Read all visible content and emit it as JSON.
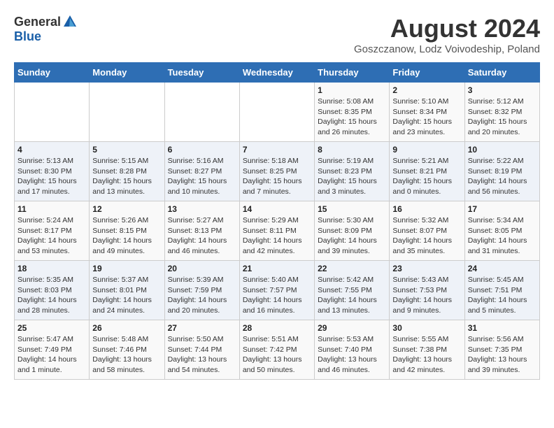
{
  "header": {
    "logo_general": "General",
    "logo_blue": "Blue",
    "title": "August 2024",
    "location": "Goszczanow, Lodz Voivodeship, Poland"
  },
  "weekdays": [
    "Sunday",
    "Monday",
    "Tuesday",
    "Wednesday",
    "Thursday",
    "Friday",
    "Saturday"
  ],
  "weeks": [
    [
      {
        "day": "",
        "info": ""
      },
      {
        "day": "",
        "info": ""
      },
      {
        "day": "",
        "info": ""
      },
      {
        "day": "",
        "info": ""
      },
      {
        "day": "1",
        "info": "Sunrise: 5:08 AM\nSunset: 8:35 PM\nDaylight: 15 hours\nand 26 minutes."
      },
      {
        "day": "2",
        "info": "Sunrise: 5:10 AM\nSunset: 8:34 PM\nDaylight: 15 hours\nand 23 minutes."
      },
      {
        "day": "3",
        "info": "Sunrise: 5:12 AM\nSunset: 8:32 PM\nDaylight: 15 hours\nand 20 minutes."
      }
    ],
    [
      {
        "day": "4",
        "info": "Sunrise: 5:13 AM\nSunset: 8:30 PM\nDaylight: 15 hours\nand 17 minutes."
      },
      {
        "day": "5",
        "info": "Sunrise: 5:15 AM\nSunset: 8:28 PM\nDaylight: 15 hours\nand 13 minutes."
      },
      {
        "day": "6",
        "info": "Sunrise: 5:16 AM\nSunset: 8:27 PM\nDaylight: 15 hours\nand 10 minutes."
      },
      {
        "day": "7",
        "info": "Sunrise: 5:18 AM\nSunset: 8:25 PM\nDaylight: 15 hours\nand 7 minutes."
      },
      {
        "day": "8",
        "info": "Sunrise: 5:19 AM\nSunset: 8:23 PM\nDaylight: 15 hours\nand 3 minutes."
      },
      {
        "day": "9",
        "info": "Sunrise: 5:21 AM\nSunset: 8:21 PM\nDaylight: 15 hours\nand 0 minutes."
      },
      {
        "day": "10",
        "info": "Sunrise: 5:22 AM\nSunset: 8:19 PM\nDaylight: 14 hours\nand 56 minutes."
      }
    ],
    [
      {
        "day": "11",
        "info": "Sunrise: 5:24 AM\nSunset: 8:17 PM\nDaylight: 14 hours\nand 53 minutes."
      },
      {
        "day": "12",
        "info": "Sunrise: 5:26 AM\nSunset: 8:15 PM\nDaylight: 14 hours\nand 49 minutes."
      },
      {
        "day": "13",
        "info": "Sunrise: 5:27 AM\nSunset: 8:13 PM\nDaylight: 14 hours\nand 46 minutes."
      },
      {
        "day": "14",
        "info": "Sunrise: 5:29 AM\nSunset: 8:11 PM\nDaylight: 14 hours\nand 42 minutes."
      },
      {
        "day": "15",
        "info": "Sunrise: 5:30 AM\nSunset: 8:09 PM\nDaylight: 14 hours\nand 39 minutes."
      },
      {
        "day": "16",
        "info": "Sunrise: 5:32 AM\nSunset: 8:07 PM\nDaylight: 14 hours\nand 35 minutes."
      },
      {
        "day": "17",
        "info": "Sunrise: 5:34 AM\nSunset: 8:05 PM\nDaylight: 14 hours\nand 31 minutes."
      }
    ],
    [
      {
        "day": "18",
        "info": "Sunrise: 5:35 AM\nSunset: 8:03 PM\nDaylight: 14 hours\nand 28 minutes."
      },
      {
        "day": "19",
        "info": "Sunrise: 5:37 AM\nSunset: 8:01 PM\nDaylight: 14 hours\nand 24 minutes."
      },
      {
        "day": "20",
        "info": "Sunrise: 5:39 AM\nSunset: 7:59 PM\nDaylight: 14 hours\nand 20 minutes."
      },
      {
        "day": "21",
        "info": "Sunrise: 5:40 AM\nSunset: 7:57 PM\nDaylight: 14 hours\nand 16 minutes."
      },
      {
        "day": "22",
        "info": "Sunrise: 5:42 AM\nSunset: 7:55 PM\nDaylight: 14 hours\nand 13 minutes."
      },
      {
        "day": "23",
        "info": "Sunrise: 5:43 AM\nSunset: 7:53 PM\nDaylight: 14 hours\nand 9 minutes."
      },
      {
        "day": "24",
        "info": "Sunrise: 5:45 AM\nSunset: 7:51 PM\nDaylight: 14 hours\nand 5 minutes."
      }
    ],
    [
      {
        "day": "25",
        "info": "Sunrise: 5:47 AM\nSunset: 7:49 PM\nDaylight: 14 hours\nand 1 minute."
      },
      {
        "day": "26",
        "info": "Sunrise: 5:48 AM\nSunset: 7:46 PM\nDaylight: 13 hours\nand 58 minutes."
      },
      {
        "day": "27",
        "info": "Sunrise: 5:50 AM\nSunset: 7:44 PM\nDaylight: 13 hours\nand 54 minutes."
      },
      {
        "day": "28",
        "info": "Sunrise: 5:51 AM\nSunset: 7:42 PM\nDaylight: 13 hours\nand 50 minutes."
      },
      {
        "day": "29",
        "info": "Sunrise: 5:53 AM\nSunset: 7:40 PM\nDaylight: 13 hours\nand 46 minutes."
      },
      {
        "day": "30",
        "info": "Sunrise: 5:55 AM\nSunset: 7:38 PM\nDaylight: 13 hours\nand 42 minutes."
      },
      {
        "day": "31",
        "info": "Sunrise: 5:56 AM\nSunset: 7:35 PM\nDaylight: 13 hours\nand 39 minutes."
      }
    ]
  ]
}
